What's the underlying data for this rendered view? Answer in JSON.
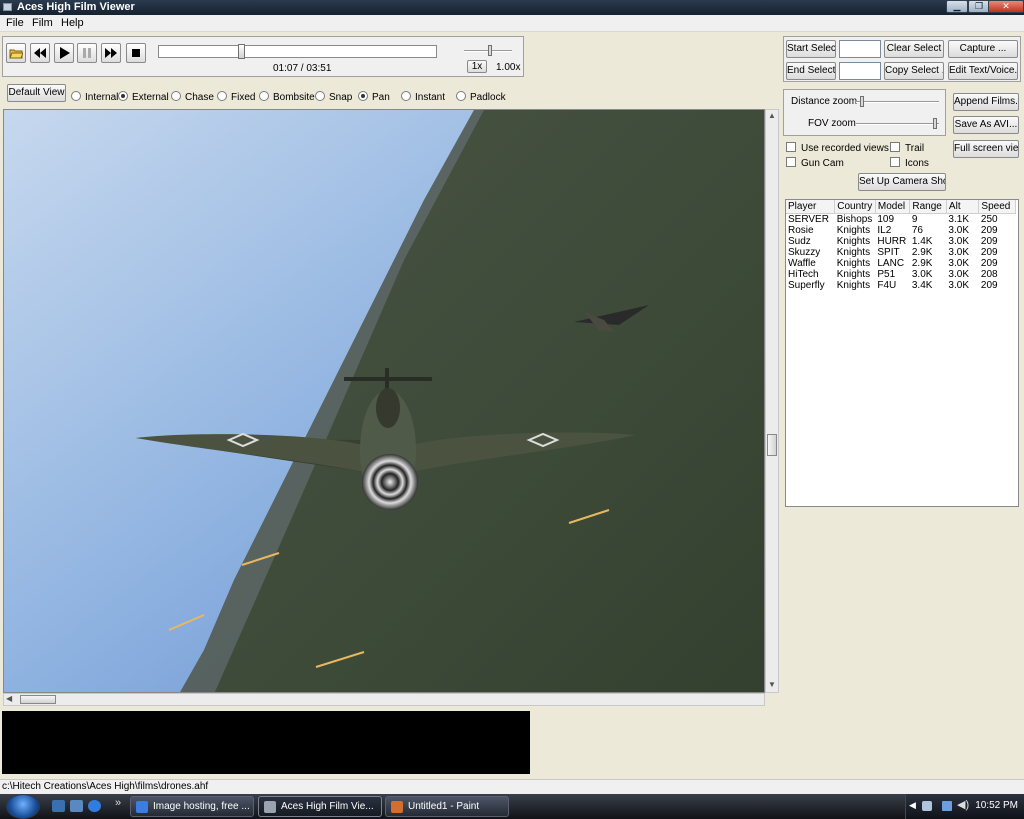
{
  "window": {
    "title": "Aces High Film Viewer",
    "minimize": "▁",
    "maximize": "❐",
    "close": "✕"
  },
  "menu": [
    "File",
    "Film",
    "Help"
  ],
  "playback": {
    "time": "01:07 / 03:51",
    "position_fraction": 0.29,
    "speed_label": "1x",
    "speed_value": "1.00x"
  },
  "views": {
    "default_button": "Default View",
    "camera_modes": [
      {
        "label": "Internal",
        "selected": false
      },
      {
        "label": "External",
        "selected": true
      },
      {
        "label": "Chase",
        "selected": false
      },
      {
        "label": "Fixed",
        "selected": false
      },
      {
        "label": "Bombsite",
        "selected": false
      },
      {
        "label": "Snap",
        "selected": false
      },
      {
        "label": "Pan",
        "selected": true
      },
      {
        "label": "Instant",
        "selected": false
      },
      {
        "label": "Padlock",
        "selected": false
      }
    ]
  },
  "selection": {
    "start_select": "Start Select",
    "end_select": "End Select",
    "clear_select": "Clear Select",
    "copy_select": "Copy Select ...",
    "capture": "Capture ...",
    "edit_text_voice": "Edit Text/Voice..."
  },
  "zoom": {
    "distance_label": "Distance zoom",
    "fov_label": "FOV zoom",
    "distance_level": 0.05,
    "fov_level": 0.98
  },
  "film_actions": {
    "append_films": "Append Films...",
    "save_as_avi": "Save As AVI...",
    "full_screen_view": "Full screen view"
  },
  "options": {
    "use_recorded_views": "Use recorded views",
    "gun_cam": "Gun Cam",
    "trail": "Trail",
    "icons": "Icons",
    "setup_camera_shots": "Set Up Camera Shots"
  },
  "players": {
    "columns": [
      "Player",
      "Country",
      "Model",
      "Range",
      "Alt",
      "Speed"
    ],
    "rows": [
      [
        "SERVER",
        "Bishops",
        "109",
        "9",
        "3.1K",
        "250"
      ],
      [
        "Rosie",
        "Knights",
        "IL2",
        "76",
        "3.0K",
        "209"
      ],
      [
        "Sudz",
        "Knights",
        "HURR",
        "1.4K",
        "3.0K",
        "209"
      ],
      [
        "Skuzzy",
        "Knights",
        "SPIT",
        "2.9K",
        "3.0K",
        "209"
      ],
      [
        "Waffle",
        "Knights",
        "LANC",
        "2.9K",
        "3.0K",
        "209"
      ],
      [
        "HiTech",
        "Knights",
        "P51",
        "3.0K",
        "3.0K",
        "208"
      ],
      [
        "Superfly",
        "Knights",
        "F4U",
        "3.4K",
        "3.0K",
        "209"
      ]
    ]
  },
  "file_path": "c:\\Hitech Creations\\Aces High\\films\\drones.ahf",
  "taskbar": {
    "items": [
      {
        "label": "Image hosting, free ...",
        "color": "#3b7de0"
      },
      {
        "label": "Aces High Film Vie...",
        "color": "#9aa4b0"
      },
      {
        "label": "Untitled1 - Paint",
        "color": "#d07030"
      }
    ],
    "clock": "10:52 PM"
  }
}
